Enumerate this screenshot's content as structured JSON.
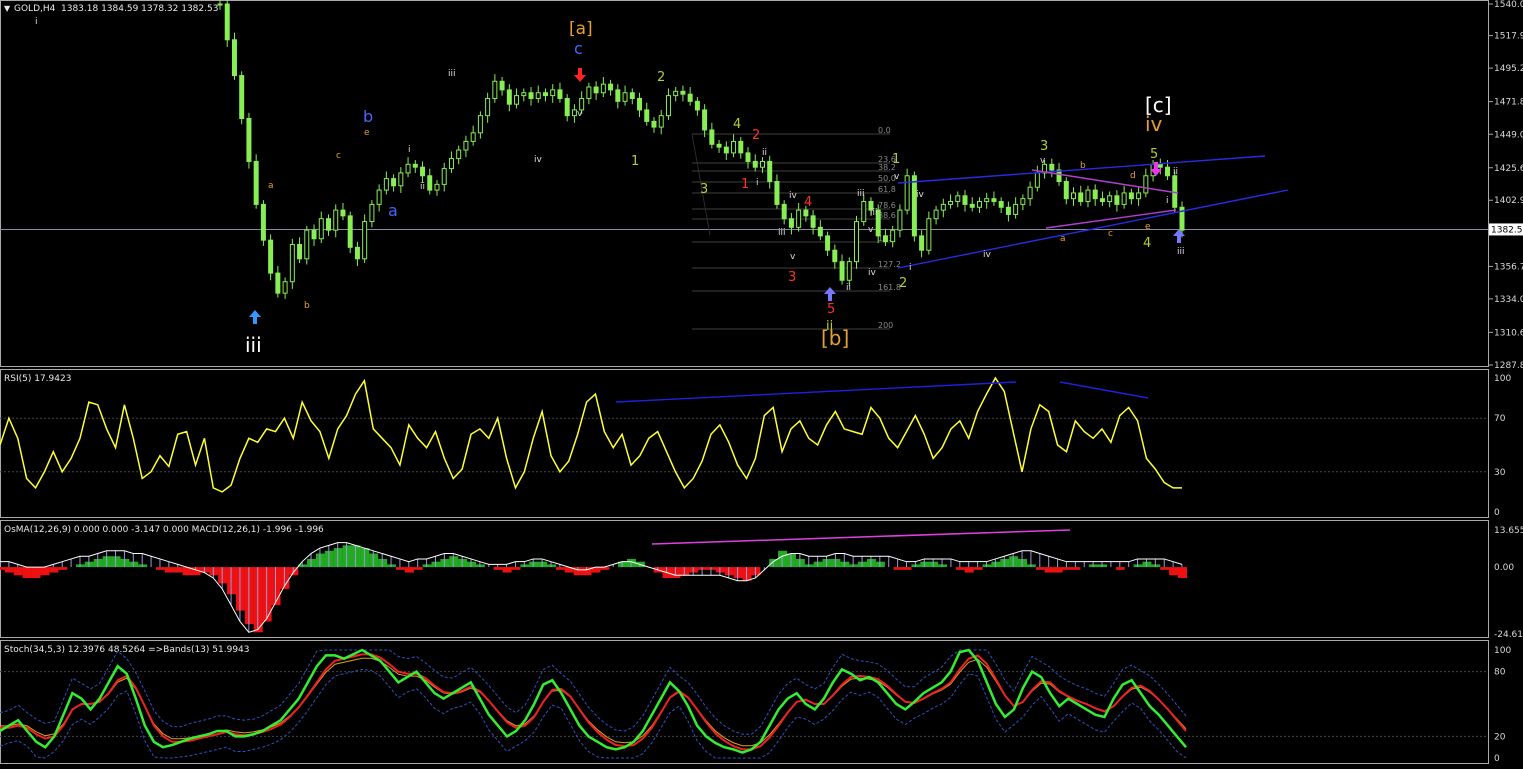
{
  "chart_data": [
    {
      "type": "line",
      "panel": "price",
      "symbol_header": "GOLD,H4",
      "ohlc_header": "1383.18 1384.59 1378.32 1382.53",
      "current_price_label": "1382.5",
      "y_ticks": [
        "1540.0",
        "1517.9",
        "1495.2",
        "1471.8",
        "1449.0",
        "1425.6",
        "1402.9",
        "1380.2",
        "1356.7",
        "1334.0",
        "1310.6",
        "1287.8"
      ],
      "ylim": [
        1287.8,
        1540.0
      ],
      "grid": false,
      "series": [
        {
          "values": [
            1540,
            1515,
            1490,
            1460,
            1430,
            1400,
            1375,
            1352,
            1338,
            1346,
            1372,
            1362,
            1382,
            1376,
            1390,
            1382,
            1396,
            1392,
            1370,
            1362,
            1388,
            1400,
            1410,
            1418,
            1413,
            1422,
            1428,
            1426,
            1420,
            1410,
            1414,
            1425,
            1432,
            1438,
            1444,
            1450,
            1462,
            1474,
            1486,
            1480,
            1470,
            1476,
            1478,
            1474,
            1478,
            1476,
            1480,
            1474,
            1462,
            1466,
            1474,
            1482,
            1478,
            1484,
            1480,
            1472,
            1478,
            1474,
            1466,
            1458,
            1454,
            1462,
            1476,
            1479,
            1477,
            1472,
            1466,
            1452,
            1442,
            1440,
            1436,
            1444,
            1436,
            1430,
            1426,
            1430,
            1416,
            1400,
            1390,
            1384,
            1396,
            1392,
            1384,
            1378,
            1368,
            1360,
            1347,
            1360,
            1388,
            1402,
            1396,
            1378,
            1374,
            1382,
            1396,
            1420,
            1378,
            1368,
            1390,
            1396,
            1400,
            1402,
            1406,
            1400,
            1398,
            1402,
            1404,
            1402,
            1398,
            1393,
            1400,
            1404,
            1412,
            1422,
            1428,
            1424,
            1416,
            1404,
            1408,
            1402,
            1410,
            1404,
            1402,
            1406,
            1400,
            1408,
            1404,
            1408,
            1420,
            1428,
            1426,
            1420,
            1398,
            1382
          ]
        }
      ],
      "trendlines": [
        {
          "name": "upper-channel",
          "color": "#2a2ae0"
        },
        {
          "name": "lower-channel",
          "color": "#2a2ae0"
        },
        {
          "name": "triangle-top",
          "color": "#b040d0"
        },
        {
          "name": "triangle-bottom",
          "color": "#b040d0"
        }
      ],
      "fib_levels": [
        "0.0",
        "23.6",
        "38.2",
        "50.0",
        "61.8",
        "78.6",
        "88.6",
        "113",
        "127.2",
        "161.8",
        "200"
      ],
      "annotations": [
        "iii",
        "a",
        "b",
        "c",
        "e",
        "a",
        "b",
        "i",
        "ii",
        "iii",
        "iv",
        "v",
        "c",
        "[a]",
        "1",
        "2",
        "3",
        "4",
        "1",
        "i",
        "ii",
        "iii",
        "iv",
        "v",
        "2",
        "3",
        "4",
        "5",
        "[b]",
        "1",
        "v",
        "ii",
        "iii",
        "iv",
        "i",
        "2",
        "3",
        "iv",
        "iv",
        "[c]",
        "a",
        "b",
        "c",
        "d",
        "e",
        "v",
        "5",
        "4",
        "ii",
        "i",
        "iii",
        "i",
        "ii",
        "iii",
        "iv",
        "v"
      ]
    },
    {
      "type": "line",
      "panel": "rsi",
      "title": "RSI(5) 17.9423",
      "y_ticks": [
        "100",
        "70",
        "30",
        "0"
      ],
      "ylim": [
        0,
        100
      ],
      "series": [
        {
          "color": "#ffff33",
          "values": [
            50,
            70,
            55,
            25,
            18,
            30,
            45,
            30,
            40,
            55,
            82,
            80,
            62,
            48,
            80,
            55,
            25,
            30,
            42,
            34,
            58,
            60,
            35,
            55,
            18,
            15,
            20,
            40,
            55,
            52,
            62,
            60,
            70,
            55,
            82,
            68,
            60,
            40,
            62,
            72,
            88,
            98,
            62,
            55,
            48,
            35,
            65,
            55,
            48,
            60,
            40,
            25,
            32,
            58,
            62,
            55,
            70,
            40,
            18,
            30,
            55,
            75,
            42,
            30,
            38,
            58,
            82,
            88,
            60,
            48,
            58,
            35,
            42,
            55,
            60,
            45,
            30,
            18,
            25,
            38,
            58,
            65,
            52,
            35,
            25,
            40,
            72,
            78,
            45,
            62,
            68,
            55,
            50,
            65,
            75,
            62,
            60,
            58,
            78,
            70,
            55,
            48,
            60,
            72,
            58,
            40,
            48,
            62,
            68,
            55,
            75,
            88,
            100,
            90,
            60,
            30,
            62,
            80,
            75,
            50,
            45,
            68,
            60,
            55,
            62,
            52,
            72,
            78,
            68,
            40,
            32,
            22,
            18,
            18
          ]
        },
        {
          "name": "divergence-1",
          "color": "#2020e0"
        },
        {
          "name": "divergence-2",
          "color": "#2020e0"
        }
      ]
    },
    {
      "type": "bar",
      "panel": "osma",
      "title": "OsMA(12,26,9) 0.000 0.000 -3.147 0.000  MACD(12,26,1) -1.996 -1.996",
      "y_ticks": [
        "13.655",
        "0.00",
        "-24.618"
      ],
      "ylim": [
        -24.618,
        13.655
      ],
      "osma": [
        -1,
        -2,
        -3,
        -4,
        -4,
        -3,
        -2,
        -1,
        0,
        1,
        2,
        3,
        4,
        4,
        3,
        2,
        1,
        0,
        -1,
        -2,
        -2,
        -3,
        -3,
        -2,
        -3,
        -6,
        -10,
        -16,
        -21,
        -24,
        -20,
        -14,
        -8,
        -3,
        1,
        3,
        5,
        6,
        7,
        8,
        8,
        7,
        5,
        3,
        1,
        -1,
        -2,
        -1,
        1,
        2,
        3,
        4,
        3,
        2,
        1,
        0,
        -1,
        -2,
        -1,
        1,
        2,
        2,
        1,
        -1,
        -2,
        -3,
        -3,
        -2,
        -1,
        0,
        2,
        3,
        2,
        0,
        -2,
        -4,
        -4,
        -3,
        -2,
        -1,
        -1,
        -2,
        -3,
        -4,
        -5,
        -3,
        0,
        3,
        6,
        5,
        3,
        1,
        2,
        3,
        3,
        2,
        1,
        2,
        3,
        2,
        0,
        -1,
        -1,
        1,
        2,
        2,
        1,
        0,
        -1,
        -2,
        -1,
        1,
        2,
        3,
        4,
        3,
        1,
        -1,
        -2,
        -2,
        -1,
        -1,
        0,
        1,
        1,
        0,
        -1,
        0,
        1,
        2,
        1,
        -1,
        -3,
        -4
      ],
      "macd": [
        2,
        2,
        1,
        0,
        0,
        0,
        1,
        2,
        3,
        4,
        4,
        5,
        6,
        6,
        6,
        5,
        5,
        4,
        3,
        2,
        1,
        0,
        -1,
        -2,
        -4,
        -8,
        -14,
        -20,
        -24,
        -23,
        -19,
        -13,
        -7,
        -2,
        2,
        5,
        7,
        8,
        9,
        9,
        8,
        7,
        6,
        5,
        4,
        3,
        2,
        3,
        3,
        4,
        5,
        5,
        4,
        3,
        2,
        1,
        1,
        1,
        2,
        2,
        3,
        3,
        2,
        1,
        0,
        -1,
        -1,
        0,
        0,
        1,
        2,
        2,
        1,
        0,
        -1,
        -2,
        -3,
        -3,
        -3,
        -3,
        -3,
        -3,
        -4,
        -5,
        -5,
        -4,
        -1,
        2,
        4,
        5,
        5,
        4,
        4,
        4,
        5,
        5,
        4,
        4,
        4,
        4,
        4,
        3,
        2,
        2,
        3,
        3,
        3,
        3,
        2,
        2,
        2,
        2,
        3,
        4,
        5,
        6,
        6,
        5,
        4,
        3,
        2,
        2,
        2,
        2,
        2,
        2,
        2,
        2,
        3,
        3,
        3,
        3,
        2,
        1
      ],
      "series": [
        {
          "name": "divergence",
          "color": "#e040e0"
        }
      ]
    },
    {
      "type": "line",
      "panel": "stochastic",
      "title": "Stoch(34,5,3) 12.3976 48.5264  =>Bands(13) 51.9943",
      "y_ticks": [
        "100",
        "80",
        "20",
        "0"
      ],
      "ylim": [
        0,
        100
      ],
      "series": [
        {
          "color": "#33ee33",
          "values": [
            25,
            30,
            35,
            25,
            15,
            10,
            20,
            40,
            60,
            55,
            45,
            55,
            70,
            85,
            78,
            55,
            30,
            15,
            10,
            12,
            15,
            18,
            20,
            22,
            25,
            25,
            20,
            20,
            22,
            25,
            30,
            35,
            45,
            55,
            70,
            85,
            95,
            95,
            92,
            96,
            100,
            95,
            90,
            80,
            70,
            75,
            80,
            70,
            60,
            55,
            60,
            65,
            70,
            55,
            40,
            30,
            20,
            25,
            35,
            50,
            68,
            72,
            60,
            45,
            30,
            20,
            15,
            10,
            8,
            10,
            15,
            25,
            40,
            55,
            70,
            62,
            48,
            30,
            20,
            14,
            10,
            8,
            5,
            8,
            15,
            30,
            45,
            55,
            60,
            50,
            45,
            55,
            70,
            82,
            78,
            72,
            75,
            70,
            60,
            50,
            45,
            52,
            60,
            65,
            70,
            80,
            98,
            100,
            90,
            70,
            50,
            38,
            45,
            65,
            80,
            75,
            60,
            48,
            55,
            50,
            45,
            40,
            38,
            55,
            68,
            72,
            60,
            48,
            40,
            30,
            20,
            10
          ]
        },
        {
          "color": "#ee2222",
          "values": [
            28,
            28,
            30,
            28,
            22,
            18,
            20,
            30,
            45,
            50,
            50,
            52,
            60,
            72,
            76,
            65,
            48,
            30,
            20,
            15,
            15,
            16,
            18,
            20,
            22,
            24,
            22,
            21,
            22,
            24,
            27,
            31,
            38,
            47,
            58,
            70,
            82,
            90,
            92,
            94,
            96,
            96,
            93,
            87,
            80,
            78,
            78,
            74,
            67,
            61,
            60,
            62,
            66,
            62,
            53,
            43,
            33,
            28,
            30,
            38,
            52,
            63,
            64,
            57,
            45,
            33,
            24,
            17,
            12,
            11,
            12,
            18,
            28,
            42,
            56,
            62,
            56,
            45,
            33,
            23,
            16,
            11,
            8,
            8,
            11,
            19,
            30,
            42,
            52,
            54,
            50,
            50,
            58,
            68,
            75,
            76,
            75,
            73,
            67,
            59,
            52,
            51,
            55,
            60,
            64,
            70,
            82,
            92,
            95,
            87,
            73,
            58,
            48,
            52,
            63,
            71,
            70,
            62,
            57,
            53,
            50,
            46,
            43,
            48,
            57,
            65,
            67,
            62,
            54,
            45,
            35,
            25
          ]
        },
        {
          "color": "#e0a020",
          "name": "bands-mid"
        },
        {
          "color": "#3050c0",
          "name": "bands-upper"
        },
        {
          "color": "#3050c0",
          "name": "bands-lower"
        }
      ]
    }
  ]
}
